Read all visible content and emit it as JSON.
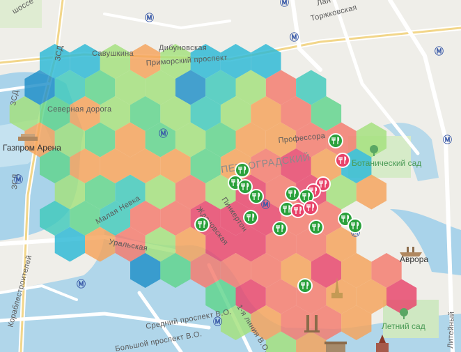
{
  "map": {
    "labels": {
      "dibunovskaya": "Дибуновская",
      "savushkina": "Савушкина",
      "primorsky": "Приморский проспект",
      "torzhkovskaya": "Торжковская",
      "lanskaya": "Лан",
      "shosse": "шоссе",
      "zsd_1": "ЗСД",
      "zsd_2": "ЗСД",
      "zsd_3": "ЗСД",
      "severnaya_doroga": "Северная дорога",
      "gazprom_arena": "Газпром Арена",
      "professora": "Профессора",
      "petrogradsky": "ПЕТРОГРАДСКИЙ",
      "botanichesky": "Ботанический сад",
      "pinkerton": "Пинкертон",
      "zhdanovskaya": "Ждановская",
      "malaya_nevka": "Малая Невка",
      "uralskaya": "Уральская",
      "korablestroiteley": "Кораблестроителей",
      "prospekt_vo_1": "Средний проспект В.О.",
      "prospekt_vo_2": "Большой проспект В.О.",
      "liniya": "1-я линия В.О.",
      "avrora": "Аврора",
      "letny_sad": "Летний сад",
      "liteyny": "Литейный"
    },
    "colors": {
      "hot": "#e8436a",
      "warm": "#f47a6c",
      "mild": "#f5a25a",
      "yellow": "#f1c75a",
      "lightgreen": "#a3e07c",
      "green": "#5fd48c",
      "teal": "#3fc9bc",
      "cyan": "#2bb8d6",
      "blue": "#1e8fc8",
      "pin": "#2aa13b"
    },
    "metro_icon": "metro-icon",
    "restaurant_icon": "fork-knife-icon"
  }
}
